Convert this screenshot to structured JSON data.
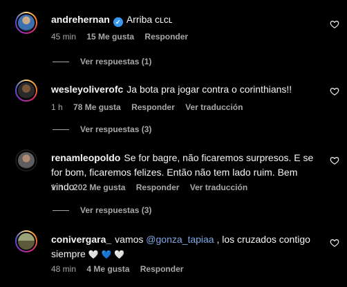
{
  "comments": [
    {
      "username": "andrehernan",
      "verified": true,
      "text": "Arriba ᴄʟᴄʟ",
      "time": "45 min",
      "likes": "15 Me gusta",
      "reply": "Responder",
      "view_replies": "Ver respuestas (1)"
    },
    {
      "username": "wesleyoliverofc",
      "text": "Ja bota pra jogar contra o corinthians!!",
      "time": "1 h",
      "likes": "78 Me gusta",
      "reply": "Responder",
      "translate": "Ver traducción",
      "view_replies": "Ver respuestas (3)"
    },
    {
      "username": "renamleopoldo",
      "text": "Se for bagre, não ficaremos surpresos. E se for bom, ficaremos felizes. Então não tem lado ruim. Bem vindo.",
      "time": "1 h",
      "likes": "202 Me gusta",
      "reply": "Responder",
      "translate": "Ver traducción",
      "view_replies": "Ver respuestas (3)"
    },
    {
      "username": "conivergara_",
      "text_before": "vamos ",
      "mention": "@gonza_tapiaa",
      "text_after": " , los cruzados contigo siempre ",
      "emojis": [
        "🤍",
        "💙",
        "🤍"
      ],
      "time": "48 min",
      "likes": "4 Me gusta",
      "reply": "Responder"
    }
  ],
  "icons": {
    "verified": "verified-badge-icon",
    "like": "heart-outline-icon"
  },
  "colors": {
    "background": "#000000",
    "muted": "#a8a8a8",
    "verified": "#3897f0",
    "mention": "#7fa8e8"
  }
}
